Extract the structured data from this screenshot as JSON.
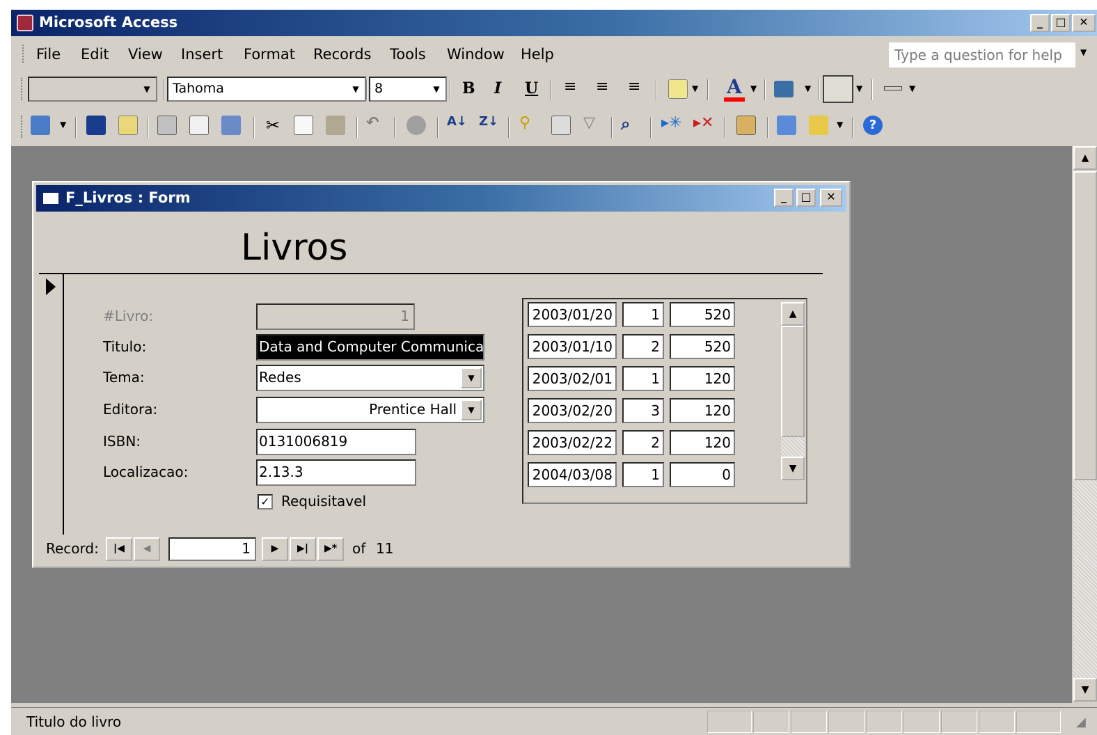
{
  "app": {
    "title": "Microsoft Access",
    "menus": [
      "File",
      "Edit",
      "View",
      "Insert",
      "Format",
      "Records",
      "Tools",
      "Window",
      "Help"
    ],
    "help_placeholder": "Type a question for help"
  },
  "format_toolbar": {
    "object_combo": "",
    "font_name": "Tahoma",
    "font_size": "8",
    "bold": "B",
    "italic": "I",
    "underline": "U",
    "font_color_label": "A"
  },
  "form": {
    "window_title": "F_Livros : Form",
    "heading": "Livros",
    "fields": {
      "livro_label": "#Livro:",
      "livro_value": "1",
      "titulo_label": "Titulo:",
      "titulo_value": "Data and Computer Communications",
      "tema_label": "Tema:",
      "tema_value": "Redes",
      "editora_label": "Editora:",
      "editora_value": "Prentice Hall",
      "isbn_label": "ISBN:",
      "isbn_value": "0131006819",
      "localizacao_label": "Localizacao:",
      "localizacao_value": "2.13.3",
      "requisitavel_label": "Requisitavel",
      "requisitavel_checked": true
    },
    "subform_rows": [
      {
        "date": "2003/01/20",
        "qty": "1",
        "value": "520"
      },
      {
        "date": "2003/01/10",
        "qty": "2",
        "value": "520"
      },
      {
        "date": "2003/02/01",
        "qty": "1",
        "value": "120"
      },
      {
        "date": "2003/02/20",
        "qty": "3",
        "value": "120"
      },
      {
        "date": "2003/02/22",
        "qty": "2",
        "value": "120"
      },
      {
        "date": "2004/03/08",
        "qty": "1",
        "value": "0"
      }
    ],
    "navigation": {
      "record_label": "Record:",
      "current": "1",
      "of_label": "of",
      "total": "11"
    }
  },
  "status": {
    "text": "Titulo do livro"
  },
  "colors": {
    "titlebar_start": "#0a246a",
    "titlebar_end": "#a6caf0",
    "face": "#d4d0c8",
    "workspace": "#808080",
    "font_color_bar": "#ff0000"
  }
}
